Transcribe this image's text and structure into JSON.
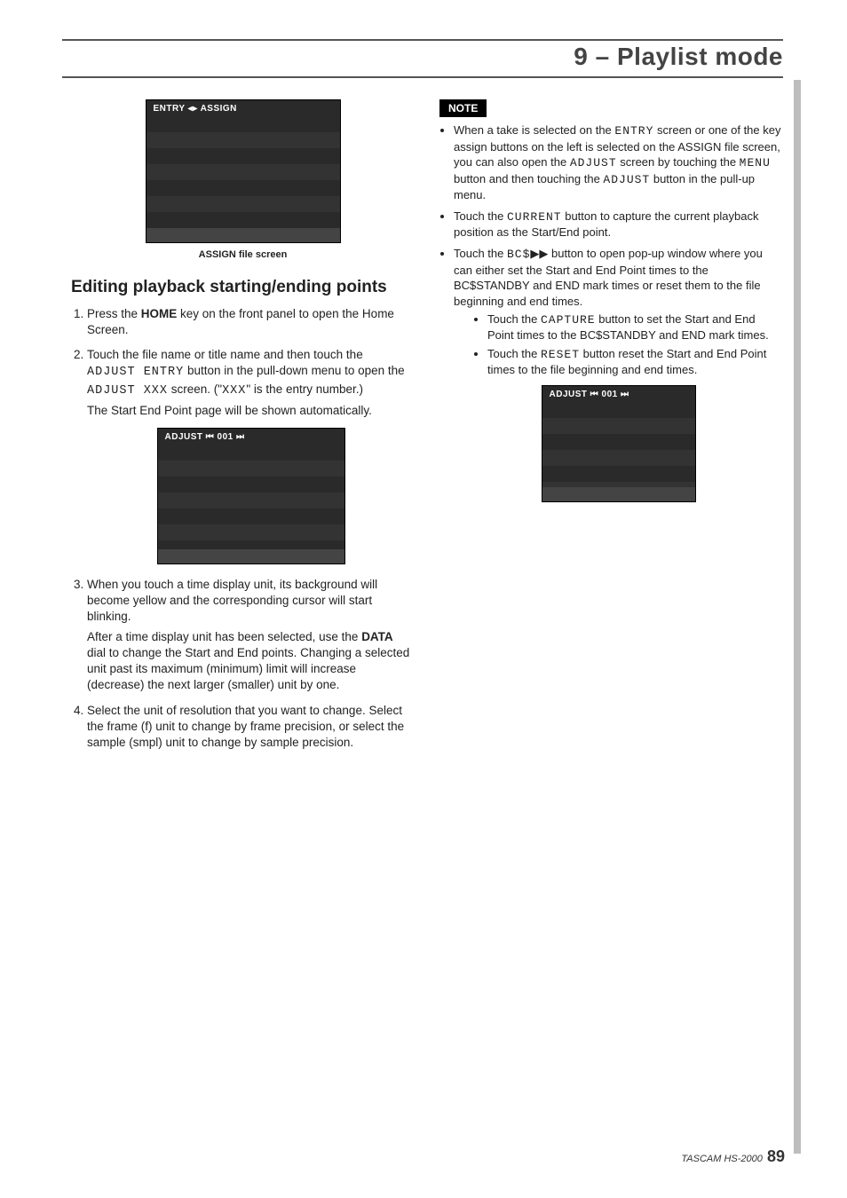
{
  "header": "9 – Playlist mode",
  "footer": {
    "product": "TASCAM  HS-2000",
    "page": "89"
  },
  "left": {
    "caption1": "ASSIGN file screen",
    "section_title": "Editing playback starting/ending points",
    "step1_a": "Press the ",
    "step1_home": "HOME",
    "step1_b": " key on the front panel to open the Home Screen.",
    "step2_a": "Touch the file name or title name and then touch the ",
    "step2_adjentry": "ADJUST ENTRY",
    "step2_b": " button in the pull-down menu to open the ",
    "step2_adjxxx": "ADJUST XXX",
    "step2_c": " screen. (\"",
    "step2_xxx": "XXX",
    "step2_d": "\" is the entry number.)",
    "step2_tail": "The Start End Point page will be shown automatically.",
    "step3": "When you touch a time display unit, its background will become yellow and the corresponding cursor will start blinking.",
    "step3_b": "After a time display unit has been selected, use the ",
    "step3_data": "DATA",
    "step3_c": " dial to change the Start and End points. Changing a selected unit past its maximum (minimum) limit will increase (decrease) the next larger (smaller) unit by one.",
    "step4": "Select the unit of resolution that you want to change. Select the frame (f) unit to change by frame precision, or select the sample (smpl) unit to change by sample precision."
  },
  "right": {
    "note_label": "NOTE",
    "b1_a": "When a take is selected on the ",
    "b1_entry": "ENTRY",
    "b1_b": " screen or one of the key assign buttons on the left is selected on the ASSIGN file screen, you can also open the ",
    "b1_adjust": "ADJUST",
    "b1_c": " screen by touching the ",
    "b1_menu": "MENU",
    "b1_d": " button and then touching the ",
    "b1_adjust2": "ADJUST",
    "b1_e": " button in the pull-up menu.",
    "b2_a": "Touch the ",
    "b2_current": "CURRENT",
    "b2_b": " button to capture the current playback position as the Start/End point.",
    "b3_a": "Touch the ",
    "b3_bcs": "BC$",
    "b3_icon": " ▶▶ ",
    "b3_b": " button to open pop-up window where you can either set the Start and End Point times to the BC$STANDBY and END mark times or reset them to the file beginning and end times.",
    "s1_a": "Touch the ",
    "s1_capture": "CAPTURE",
    "s1_b": " button to set the Start and End Point times to the BC$STANDBY and END mark times.",
    "s2_a": "Touch the ",
    "s2_reset": "RESET",
    "s2_b": " button reset the Start and End Point times to the file beginning and end times."
  },
  "shots": {
    "s1_title": "ENTRY ◂▸ ASSIGN",
    "s2_title": "ADJUST  ⏮ 001 ⏭",
    "s3_title": "ADJUST  ⏮ 001 ⏭"
  }
}
